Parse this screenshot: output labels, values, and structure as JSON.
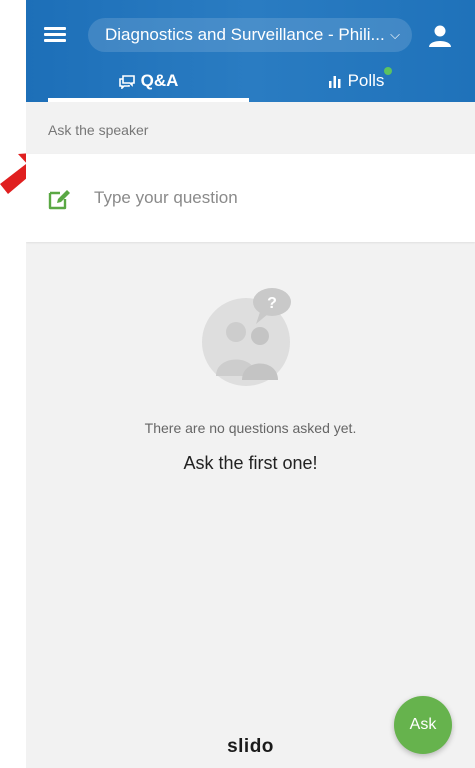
{
  "header": {
    "event_title": "Diagnostics and Surveillance - Phili...",
    "dropdown_chevron": "⌵"
  },
  "tabs": [
    {
      "label": "Q&A",
      "icon": "chat-bubbles-icon",
      "active": true
    },
    {
      "label": "Polls",
      "icon": "bar-chart-icon",
      "has_new_dot": true
    }
  ],
  "qa": {
    "section_label": "Ask the speaker",
    "input_placeholder": "Type your question",
    "empty_message": "There are no questions asked yet.",
    "empty_cta": "Ask the first one!"
  },
  "footer": {
    "brand": "slido",
    "ask_button": "Ask"
  },
  "colors": {
    "header_blue": "#1f72ba",
    "accent_green": "#66b34d",
    "notification_dot": "#5cc260",
    "annotation_arrow": "#e01f1f"
  }
}
